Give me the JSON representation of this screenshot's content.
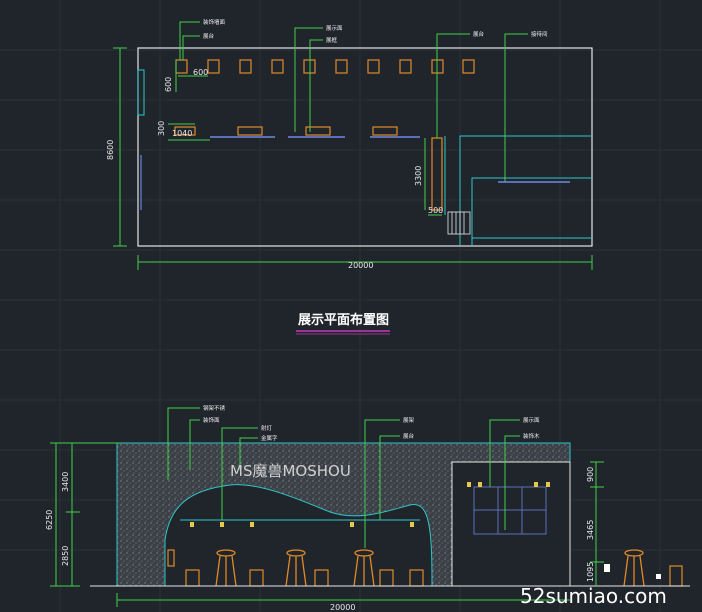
{
  "plan": {
    "title": "展示平面布置图",
    "labels": {
      "top_left_1": "装饰墙面",
      "top_left_2": "展台",
      "mid_1": "展示面",
      "mid_2": "展框",
      "right_1": "展台",
      "right_2": "接待间"
    },
    "dims": {
      "width": "20000",
      "height": "8600",
      "d600a": "600",
      "d600b": "600",
      "d300": "300",
      "d1040": "1040",
      "d3300": "3300",
      "d500": "500"
    }
  },
  "elevation": {
    "brand": "MS魔兽MOSHOU",
    "labels": {
      "l1": "钢架不锈",
      "l2": "装饰面",
      "l3": "射灯",
      "l4": "金属字",
      "l5": "展架",
      "l6": "展台",
      "l7": "展示面",
      "l8": "装饰木"
    },
    "dims": {
      "width": "20000",
      "total_h": "6250",
      "upper": "3400",
      "lower": "2850",
      "r900": "900",
      "r3465": "3465",
      "r1095": "1095"
    }
  },
  "watermark": "52sumiao.com"
}
